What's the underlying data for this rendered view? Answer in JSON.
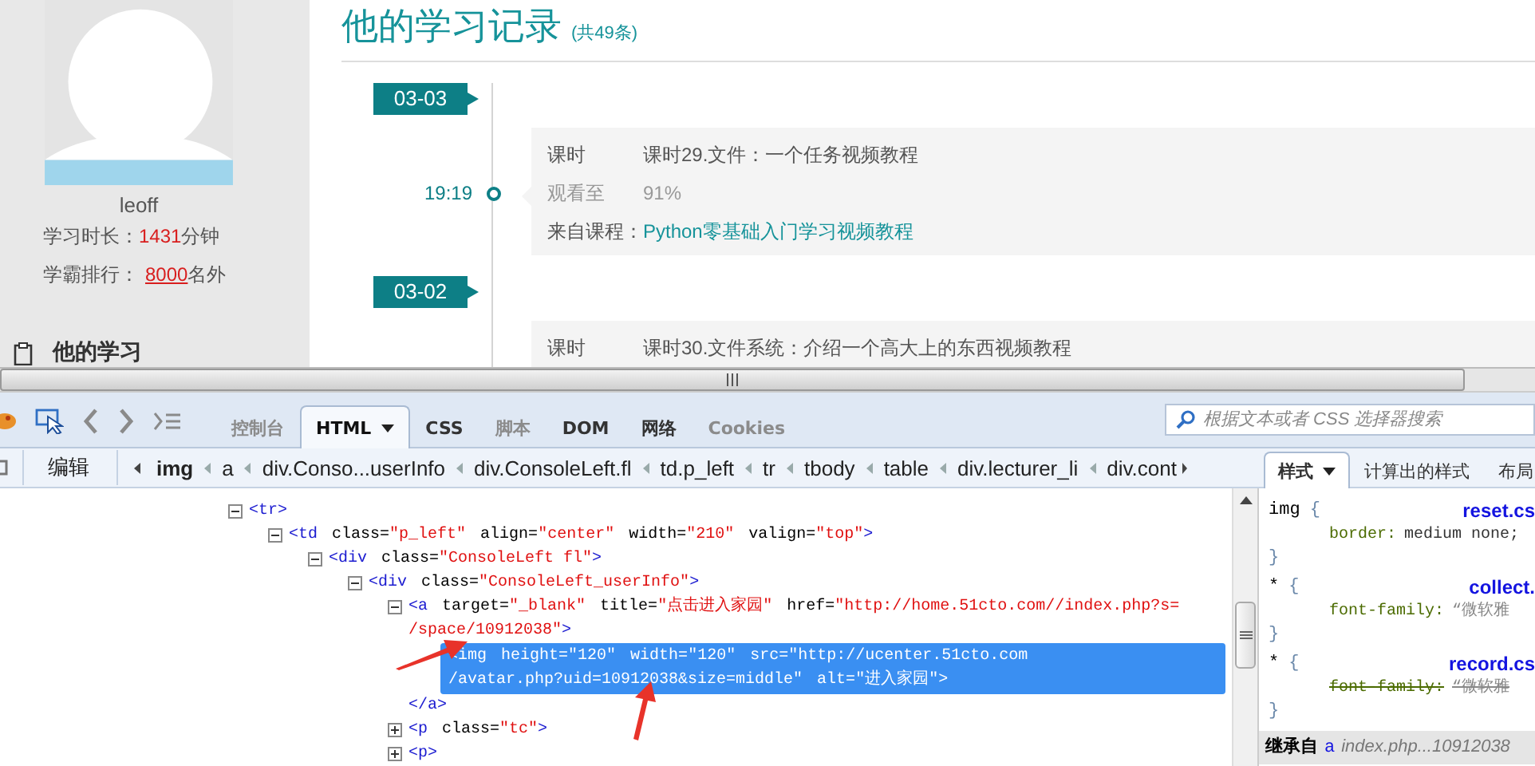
{
  "profile": {
    "username": "leoff",
    "stats": [
      {
        "kind": "plain",
        "label": "学习时长：",
        "value": "1431",
        "unit": "分钟"
      },
      {
        "kind": "link",
        "label": "学霸排行：",
        "value": "8000",
        "unit": "名外"
      }
    ]
  },
  "nav_items": [
    {
      "label": "他的学习"
    }
  ],
  "records": {
    "title": "他的学习记录",
    "count": "(共49条)",
    "days": [
      {
        "date": "03-03",
        "entries": [
          {
            "time": "19:19",
            "rows": [
              {
                "kind": "field",
                "label": "课时",
                "value": "课时29.文件：一个任务视频教程"
              },
              {
                "kind": "progress",
                "label": "观看至",
                "value": "91%"
              },
              {
                "kind": "source",
                "label": "来自课程：",
                "value": "Python零基础入门学习视频教程"
              }
            ]
          }
        ]
      },
      {
        "date": "03-02",
        "entries": [
          {
            "rows": [
              {
                "kind": "field",
                "label": "课时",
                "value": "课时30.文件系统：介绍一个高大上的东西视频教程"
              }
            ]
          }
        ]
      }
    ]
  },
  "devtools": {
    "tabs": [
      {
        "label": "控制台",
        "selected": false,
        "disabled": true,
        "dropdown": false
      },
      {
        "label": "HTML",
        "selected": true,
        "disabled": false,
        "dropdown": true
      },
      {
        "label": "CSS",
        "selected": false,
        "disabled": false,
        "dropdown": false
      },
      {
        "label": "脚本",
        "selected": false,
        "disabled": true,
        "dropdown": false
      },
      {
        "label": "DOM",
        "selected": false,
        "disabled": false,
        "dropdown": false
      },
      {
        "label": "网络",
        "selected": false,
        "disabled": false,
        "dropdown": false
      },
      {
        "label": "Cookies",
        "selected": false,
        "disabled": true,
        "dropdown": false
      }
    ],
    "search": {
      "placeholder": "根据文本或者 CSS 选择器搜索"
    },
    "edit_button": "编辑",
    "breadcrumbs": [
      {
        "label": "img",
        "selected": true
      },
      {
        "label": "a",
        "selected": false
      },
      {
        "label": "div.Conso...userInfo",
        "selected": false
      },
      {
        "label": "div.ConsoleLeft.fl",
        "selected": false
      },
      {
        "label": "td.p_left",
        "selected": false
      },
      {
        "label": "tr",
        "selected": false
      },
      {
        "label": "tbody",
        "selected": false
      },
      {
        "label": "table",
        "selected": false
      },
      {
        "label": "div.lecturer_li",
        "selected": false
      },
      {
        "label": "div.cont",
        "selected": false
      }
    ],
    "side_tabs": [
      {
        "label": "样式",
        "selected": true,
        "dropdown": true
      },
      {
        "label": "计算出的样式",
        "selected": false,
        "dropdown": false
      },
      {
        "label": "布局",
        "selected": false,
        "dropdown": false
      }
    ],
    "html_tree": [
      {
        "kind": "container",
        "open": "<tr",
        "end": ">",
        "expanded": true,
        "selected": false,
        "children": [
          {
            "kind": "container",
            "open": "<td",
            "attrs": [
              {
                "name": "class=",
                "value": "\"p_left\""
              },
              {
                "name": "align=",
                "value": "\"center\""
              },
              {
                "name": "width=",
                "value": "\"210\""
              },
              {
                "name": "valign=",
                "value": "\"top\""
              }
            ],
            "end": ">",
            "expanded": true,
            "selected": false,
            "children": [
              {
                "kind": "container",
                "open": "<div",
                "attrs": [
                  {
                    "name": "class=",
                    "value": "\"ConsoleLeft fl\""
                  }
                ],
                "end": ">",
                "expanded": true,
                "selected": false,
                "children": [
                  {
                    "kind": "container",
                    "open": "<div",
                    "attrs": [
                      {
                        "name": "class=",
                        "value": "\"ConsoleLeft_userInfo\""
                      }
                    ],
                    "end": ">",
                    "expanded": true,
                    "selected": false,
                    "children": [
                      {
                        "kind": "container",
                        "open": "<a",
                        "attrs": [
                          {
                            "name": "target=",
                            "value": "\"_blank\""
                          },
                          {
                            "name": "title=",
                            "value": "\"点击进入家园\""
                          },
                          {
                            "name": "href=",
                            "value": "\"http://home.51cto.com//index.php?s=/space/10912038\""
                          }
                        ],
                        "end": ">",
                        "expanded": true,
                        "selected": false,
                        "close": "</a>",
                        "children": [
                          {
                            "kind": "leaf",
                            "open": "<img",
                            "attrs": [
                              {
                                "name": "height=",
                                "value": "\"120\""
                              },
                              {
                                "name": "width=",
                                "value": "\"120\""
                              },
                              {
                                "name": "src=",
                                "value": "\"http://ucenter.51cto.com/avatar.php?uid=10912038&size=middle\""
                              },
                              {
                                "name": "alt=",
                                "value": "\"进入家园\""
                              }
                            ],
                            "end": ">",
                            "selected": true
                          }
                        ]
                      },
                      {
                        "kind": "container",
                        "open": "<p",
                        "attrs": [
                          {
                            "name": "class=",
                            "value": "\"tc\""
                          }
                        ],
                        "end": ">",
                        "expanded": false,
                        "selected": false
                      },
                      {
                        "kind": "container",
                        "open": "<p",
                        "end": ">",
                        "expanded": false,
                        "selected": false
                      }
                    ]
                  }
                ]
              }
            ]
          }
        ]
      }
    ],
    "style_rules": [
      {
        "selector": "img",
        "open": "{",
        "close": "}",
        "source": "reset.cs",
        "props": [
          {
            "name": "border:",
            "value": "medium none;",
            "overridden": false
          }
        ]
      },
      {
        "selector": "*",
        "open": "{",
        "close": "}",
        "source": "collect.",
        "props": [
          {
            "name": "font-family:",
            "value": "“微软雅",
            "overridden": false
          }
        ]
      },
      {
        "selector": "*",
        "open": "{",
        "close": "}",
        "source": "record.cs",
        "props": [
          {
            "name": "font-family:",
            "value": "“微软雅",
            "overridden": true
          }
        ]
      }
    ],
    "inherited": {
      "label": "继承自",
      "element": "a",
      "source": "index.php...10912038"
    }
  }
}
